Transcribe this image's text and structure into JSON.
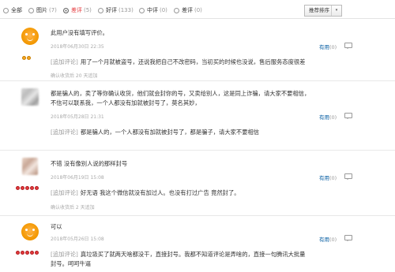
{
  "filters": [
    {
      "label": "全部",
      "count": "",
      "selected": false
    },
    {
      "label": "图片",
      "count": "(7)",
      "selected": false
    },
    {
      "label": "差评",
      "count": "(5)",
      "selected": true
    },
    {
      "label": "好评",
      "count": "(133)",
      "selected": false
    },
    {
      "label": "中评",
      "count": "(0)",
      "selected": false
    },
    {
      "label": "差评",
      "count": "(0)",
      "selected": false
    }
  ],
  "sort_button": {
    "label": "推荐排序",
    "arrow": "▾"
  },
  "reviews": [
    {
      "avatar": "orange-default-avatar",
      "badge": "gold",
      "text": "此用户没有填写评价。",
      "time": "2018年06月30日 22:35",
      "helpful_label": "有用",
      "helpful_count": "(0)",
      "append_tag": "追加评论",
      "append_text": "用了一个月就被盗号，还说我把自己不改密码，当初买的时候也没说，售后服务态度很差",
      "after_buy": "确认收货后 20 天追加"
    },
    {
      "avatar": "blurred-avatar",
      "badge": "none",
      "text_lines": [
        "都是骗人的，卖了等你确认收货，他们就会封你的号，又卖给别人，这是同上诈骗，请大家不要相信，",
        "不信可以联系我，一个人都没有加就被封号了，莫名其妙，"
      ],
      "time": "2018年05月28日 21:31",
      "helpful_label": "有用",
      "helpful_count": "(0)",
      "append_tag": "追加评论",
      "append_text": "都是骗人的，一个人都没有加就被封号了，都是骗子，请大家不要相信",
      "after_buy": ""
    },
    {
      "avatar": "blurred-avatar",
      "badge": "red",
      "text": "不错 没有像别人说的那样封号",
      "time": "2018年06月19日 15:08",
      "helpful_label": "有用",
      "helpful_count": "(0)",
      "append_tag": "追加评论",
      "append_text": "好无语 我这个微信就没有加过人。也没有打过广告 竟然封了。",
      "after_buy": "确认收货后 2 天追加"
    },
    {
      "avatar": "orange-default-avatar",
      "badge": "red",
      "text": "可以",
      "time": "2018年05月26日 15:08",
      "helpful_label": "有用",
      "helpful_count": "(0)",
      "append_tag": "追加评论",
      "append_text_lines": [
        "真垃圾买了就两天啥都没干，直接封号。我都不知道评论是弄啥的，直接一句腾讯大批量",
        "封号。呵呵牛逼"
      ],
      "after_buy": ""
    }
  ]
}
